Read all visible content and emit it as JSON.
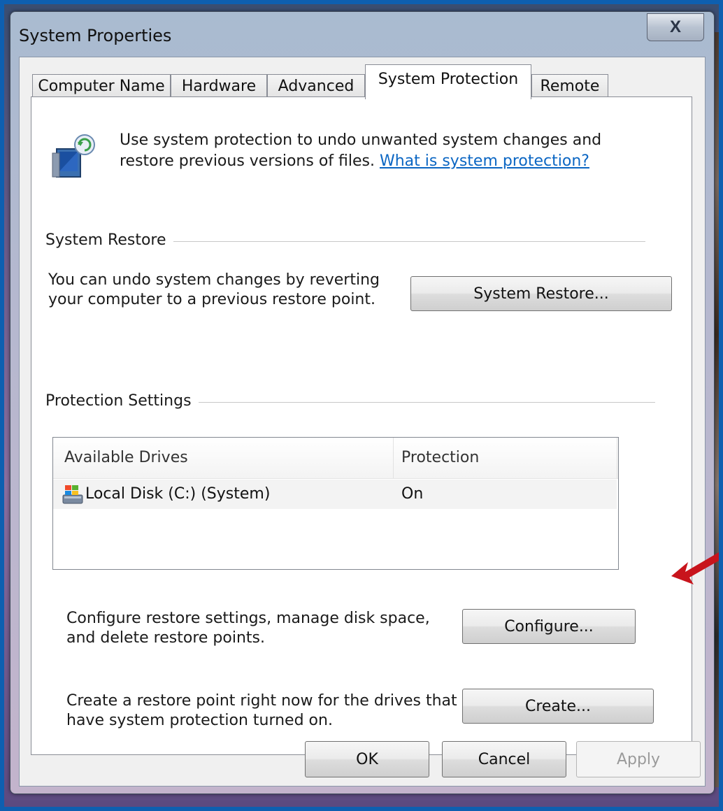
{
  "window": {
    "title": "System Properties",
    "close_label": "X"
  },
  "tabs": [
    {
      "label": "Computer Name"
    },
    {
      "label": "Hardware"
    },
    {
      "label": "Advanced"
    },
    {
      "label": "System Protection"
    },
    {
      "label": "Remote"
    }
  ],
  "active_tab": "System Protection",
  "intro": {
    "text": "Use system protection to undo unwanted system changes and",
    "text2": "restore previous versions of files.",
    "link": "What is system protection?",
    "icon": "system-protection-icon"
  },
  "system_restore": {
    "group_label": "System Restore",
    "description_line1": "You can undo system changes by reverting",
    "description_line2": "your computer to a previous restore point.",
    "button_label": "System Restore..."
  },
  "protection_settings": {
    "group_label": "Protection Settings",
    "columns": [
      "Available Drives",
      "Protection"
    ],
    "rows": [
      {
        "drive": "Local Disk (C:) (System)",
        "protection": "On",
        "icon": "windows-drive-icon"
      }
    ],
    "configure_text_line1": "Configure restore settings, manage disk space,",
    "configure_text_line2": "and delete restore points.",
    "configure_button": "Configure...",
    "create_text_line1": "Create a restore point right now for the drives that",
    "create_text_line2": "have system protection turned on.",
    "create_button": "Create..."
  },
  "footer": {
    "ok": "OK",
    "cancel": "Cancel",
    "apply": "Apply"
  },
  "colors": {
    "link": "#0b66c3",
    "arrow": "#c8141c"
  }
}
